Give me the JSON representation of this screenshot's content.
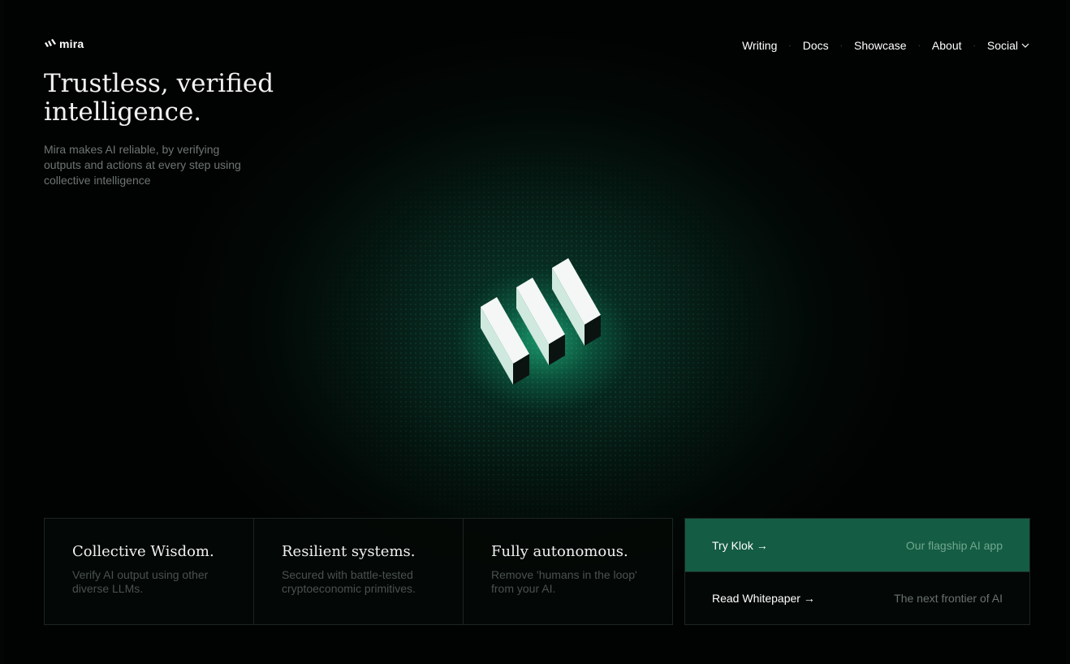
{
  "brand": {
    "name": "mira",
    "logo_icon": "mira-logo-icon",
    "accent": "#145c43"
  },
  "nav": {
    "items": [
      "Writing",
      "Docs",
      "Showcase",
      "About"
    ],
    "social_label": "Social",
    "separator": "·"
  },
  "hero": {
    "title": "Trustless, verified intelligence.",
    "subtitle": "Mira makes AI reliable, by verifying outputs and actions at every step using collective intelligence"
  },
  "features": [
    {
      "title": "Collective Wisdom.",
      "desc": "Verify AI output using other diverse LLMs."
    },
    {
      "title": "Resilient systems.",
      "desc": "Secured with battle-tested cryptoeconomic primitives."
    },
    {
      "title": "Fully autonomous.",
      "desc": "Remove 'humans in the loop' from your AI."
    }
  ],
  "cta": {
    "primary": {
      "label": "Try Klok →",
      "hint": "Our flagship AI app"
    },
    "secondary": {
      "label": "Read Whitepaper →",
      "hint": "The next frontier of AI"
    }
  }
}
